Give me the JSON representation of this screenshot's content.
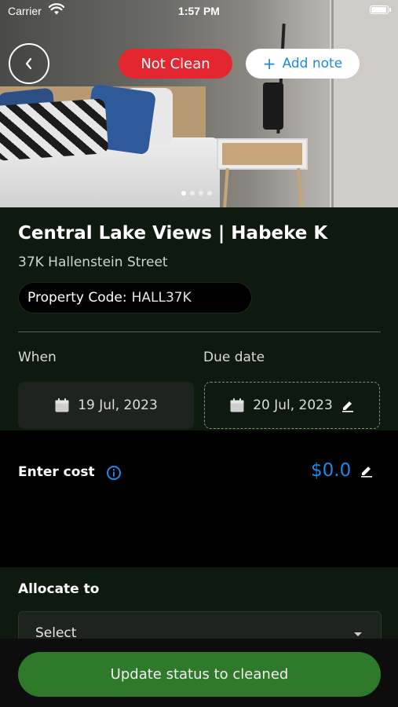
{
  "status_bar": {
    "carrier": "Carrier",
    "time": "1:57 PM",
    "battery_level": 1.0
  },
  "hero": {
    "status_badge": "Not Clean",
    "add_note_label": "Add note",
    "carousel_total": 4,
    "carousel_active": 0,
    "colors": {
      "badge_red": "#e3262f",
      "accent_blue": "#1f88e5"
    }
  },
  "property": {
    "title": "Central Lake Views | Habeke K",
    "address": "37K Hallenstein Street",
    "code_label": "Property Code:",
    "code_value": "HALL37K"
  },
  "dates": {
    "when_label": "When",
    "when_value": "19 Jul, 2023",
    "due_label": "Due date",
    "due_value": "20 Jul, 2023"
  },
  "cost": {
    "label": "Enter cost",
    "value": "$0.0"
  },
  "allocate": {
    "label": "Allocate to",
    "placeholder": "Select"
  },
  "footer": {
    "update_label": "Update status to cleaned",
    "button_color": "#2f7a2a"
  }
}
